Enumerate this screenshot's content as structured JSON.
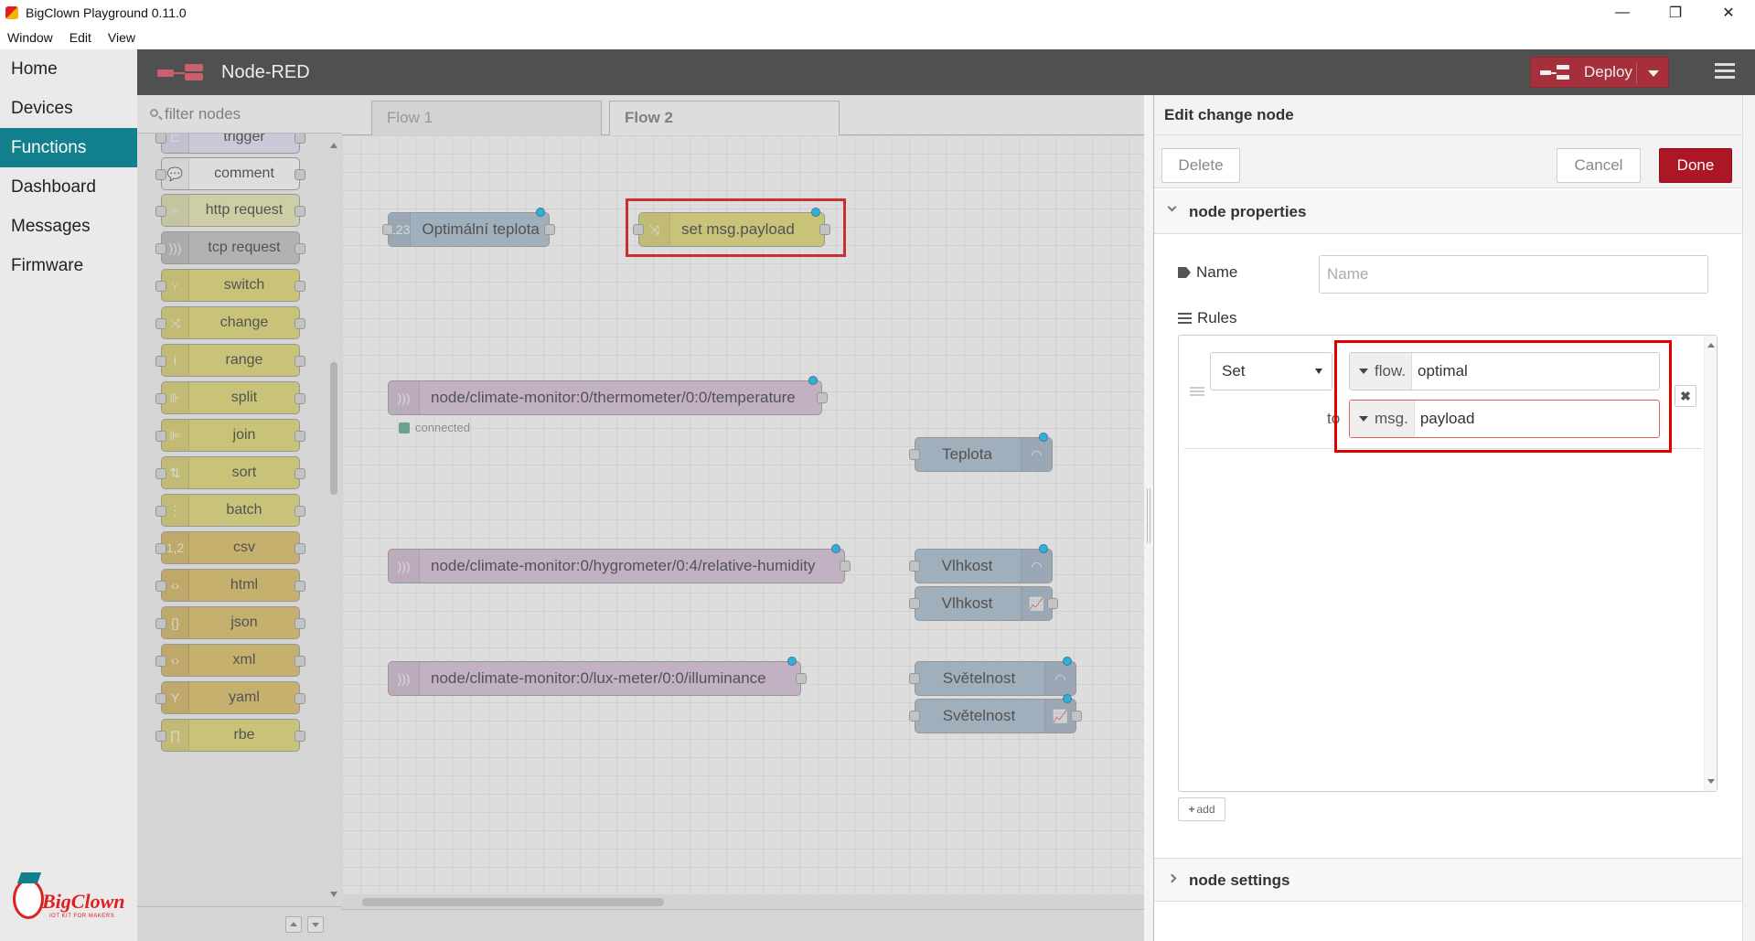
{
  "window": {
    "title": "BigClown Playground 0.11.0",
    "controls": {
      "minimize": "—",
      "restore": "❐",
      "close": "✕"
    }
  },
  "menubar": {
    "items": [
      "Window",
      "Edit",
      "View"
    ]
  },
  "app_nav": {
    "items": [
      {
        "label": "Home",
        "active": false
      },
      {
        "label": "Devices",
        "active": false
      },
      {
        "label": "Functions",
        "active": true
      },
      {
        "label": "Dashboard",
        "active": false
      },
      {
        "label": "Messages",
        "active": false
      },
      {
        "label": "Firmware",
        "active": false
      }
    ],
    "logo_text": "BigClown",
    "logo_sub": "IOT KIT FOR MAKERS"
  },
  "header": {
    "title": "Node-RED",
    "deploy_label": "Deploy"
  },
  "palette": {
    "search_placeholder": "filter nodes",
    "nodes": [
      {
        "label": "trigger",
        "color": "#e6e0f8",
        "icon": "⊏"
      },
      {
        "label": "comment",
        "color": "#ffffff",
        "icon": "💬"
      },
      {
        "label": "http request",
        "color": "#e7e7ae",
        "icon": "⌾"
      },
      {
        "label": "tcp request",
        "color": "#c0c0c0",
        "icon": ")))"
      },
      {
        "label": "switch",
        "color": "#e2d96e",
        "icon": "⑂"
      },
      {
        "label": "change",
        "color": "#e2d96e",
        "icon": "⤨"
      },
      {
        "label": "range",
        "color": "#e2d96e",
        "icon": "ⅰ"
      },
      {
        "label": "split",
        "color": "#e2d96e",
        "icon": "⊪"
      },
      {
        "label": "join",
        "color": "#e2d96e",
        "icon": "⊫"
      },
      {
        "label": "sort",
        "color": "#e2d96e",
        "icon": "⇅"
      },
      {
        "label": "batch",
        "color": "#e2d96e",
        "icon": "⋮"
      },
      {
        "label": "csv",
        "color": "#debd5c",
        "icon": "1,2"
      },
      {
        "label": "html",
        "color": "#debd5c",
        "icon": "‹›"
      },
      {
        "label": "json",
        "color": "#debd5c",
        "icon": "{}"
      },
      {
        "label": "xml",
        "color": "#debd5c",
        "icon": "‹›"
      },
      {
        "label": "yaml",
        "color": "#debd5c",
        "icon": "Y"
      },
      {
        "label": "rbe",
        "color": "#e2d96e",
        "icon": "∏"
      }
    ]
  },
  "workspace": {
    "tabs": [
      {
        "label": "Flow 1",
        "active": false
      },
      {
        "label": "Flow 2",
        "active": true
      }
    ],
    "nodes": [
      {
        "id": "inject",
        "label": "Optimální teplota",
        "color": "#a6bbcf",
        "icon": "123",
        "icon_side": "left",
        "input": true,
        "output": true,
        "changed": true
      },
      {
        "id": "change",
        "label": "set msg.payload",
        "color": "#e2d96e",
        "icon": "⤨",
        "icon_side": "left",
        "input": true,
        "output": true,
        "changed": true,
        "highlighted": true
      },
      {
        "id": "mqtt-temp",
        "label": "node/climate-monitor:0/thermometer/0:0/temperature",
        "color": "#d8bfd8",
        "icon": ")))",
        "icon_side": "left",
        "input": false,
        "output": true,
        "changed": true
      },
      {
        "id": "gauge-temp",
        "label": "Teplota",
        "color": "#a6bbcf",
        "icon": "◠",
        "icon_side": "right",
        "input": true,
        "output": false,
        "changed": true
      },
      {
        "id": "mqtt-hum",
        "label": "node/climate-monitor:0/hygrometer/0:4/relative-humidity",
        "color": "#d8bfd8",
        "icon": ")))",
        "icon_side": "left",
        "input": false,
        "output": true,
        "changed": true
      },
      {
        "id": "gauge-hum",
        "label": "Vlhkost",
        "color": "#a6bbcf",
        "icon": "◠",
        "icon_side": "right",
        "input": true,
        "output": false,
        "changed": true
      },
      {
        "id": "chart-hum",
        "label": "Vlhkost",
        "color": "#a6bbcf",
        "icon": "📈",
        "icon_side": "right",
        "input": true,
        "output": true,
        "changed": false
      },
      {
        "id": "mqtt-lux",
        "label": "node/climate-monitor:0/lux-meter/0:0/illuminance",
        "color": "#d8bfd8",
        "icon": ")))",
        "icon_side": "left",
        "input": false,
        "output": true,
        "changed": true
      },
      {
        "id": "gauge-lux",
        "label": "Světelnost",
        "color": "#a6bbcf",
        "icon": "◠",
        "icon_side": "right",
        "input": true,
        "output": false,
        "changed": true
      },
      {
        "id": "chart-lux",
        "label": "Světelnost",
        "color": "#a6bbcf",
        "icon": "📈",
        "icon_side": "right",
        "input": true,
        "output": true,
        "changed": true
      }
    ],
    "status_connected": "connected"
  },
  "tray": {
    "title": "Edit change node",
    "delete_label": "Delete",
    "cancel_label": "Cancel",
    "done_label": "Done",
    "section_properties": "node properties",
    "section_settings": "node settings",
    "name_label": "Name",
    "name_placeholder": "Name",
    "rules_label": "Rules",
    "rule": {
      "action": "Set",
      "target_type": "flow.",
      "target_value": "optimal",
      "to_label": "to",
      "source_type": "msg.",
      "source_value": "payload"
    },
    "remove_label": "✖",
    "add_label": "add"
  },
  "colors": {
    "accent": "#127f8c",
    "deploy": "#a5303c",
    "done": "#ad1625",
    "highlight": "#e00000"
  }
}
